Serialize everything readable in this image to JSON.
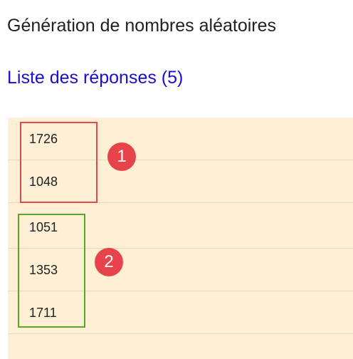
{
  "header": {
    "title": "Génération de nombres aléatoires",
    "answers_link": "Liste des réponses (5)"
  },
  "answers": [
    "1726",
    "1048",
    "1051",
    "1353",
    "1711"
  ],
  "annotations": {
    "badge_1": "1",
    "badge_2": "2",
    "colors": {
      "group_1": "#e04a4a",
      "group_2": "#5aa52a",
      "badge": "#e8424a",
      "list_background": "#fff0d5",
      "link": "#1a0dd6"
    }
  }
}
